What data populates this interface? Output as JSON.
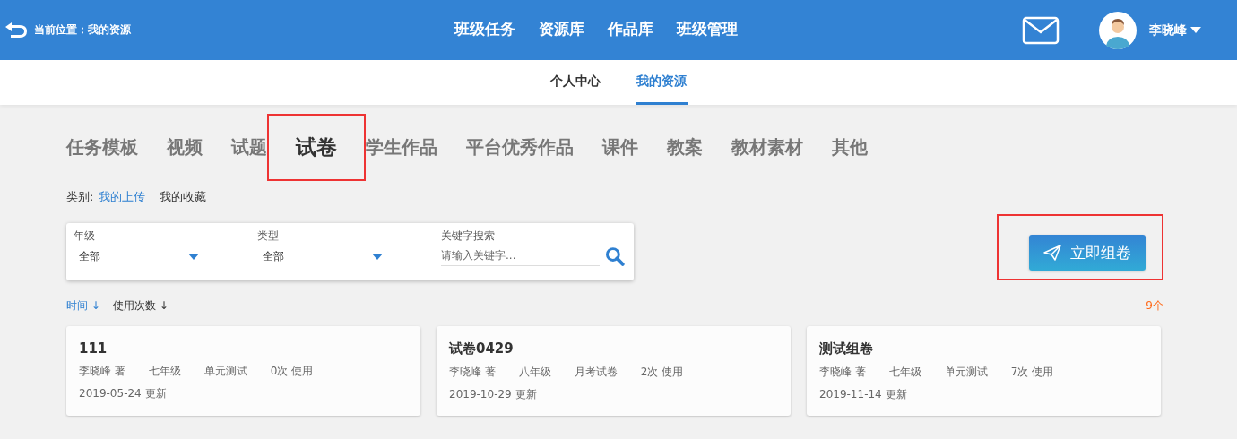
{
  "header": {
    "location": "当前位置：我的资源",
    "nav": [
      {
        "label": "班级任务"
      },
      {
        "label": "资源库"
      },
      {
        "label": "作品库"
      },
      {
        "label": "班级管理"
      }
    ],
    "user": "李晓峰"
  },
  "subnav": [
    {
      "label": "个人中心",
      "selected": false
    },
    {
      "label": "我的资源",
      "selected": true
    }
  ],
  "resource_tabs": [
    {
      "label": "任务模板",
      "selected": false,
      "highlighted": false
    },
    {
      "label": "视频",
      "selected": false,
      "highlighted": false
    },
    {
      "label": "试题",
      "selected": false,
      "highlighted": false
    },
    {
      "label": "试卷",
      "selected": true,
      "highlighted": true
    },
    {
      "label": "学生作品",
      "selected": false,
      "highlighted": false
    },
    {
      "label": "平台优秀作品",
      "selected": false,
      "highlighted": false
    },
    {
      "label": "课件",
      "selected": false,
      "highlighted": false
    },
    {
      "label": "教案",
      "selected": false,
      "highlighted": false
    },
    {
      "label": "教材素材",
      "selected": false,
      "highlighted": false
    },
    {
      "label": "其他",
      "selected": false,
      "highlighted": false
    }
  ],
  "category": {
    "label": "类别:",
    "options": [
      {
        "label": "我的上传",
        "selected": true
      },
      {
        "label": "我的收藏",
        "selected": false
      }
    ]
  },
  "filters": {
    "grade": {
      "label": "年级",
      "value": "全部"
    },
    "type": {
      "label": "类型",
      "value": "全部"
    },
    "keyword": {
      "label": "关键字搜索",
      "placeholder": "请输入关键字..."
    }
  },
  "compose_button": {
    "label": "立即组卷",
    "highlighted": true
  },
  "sort": [
    {
      "label": "时间",
      "arrow": "↓",
      "selected": true
    },
    {
      "label": "使用次数",
      "arrow": "↓",
      "selected": false
    }
  ],
  "count": "9个",
  "papers": [
    {
      "title": "111",
      "author": "李晓峰 著",
      "grade": "七年级",
      "type": "单元测试",
      "uses": "0次 使用",
      "updated": "2019-05-24 更新"
    },
    {
      "title": "试卷0429",
      "author": "李晓峰 著",
      "grade": "八年级",
      "type": "月考试卷",
      "uses": "2次 使用",
      "updated": "2019-10-29 更新"
    },
    {
      "title": "测试组卷",
      "author": "李晓峰 著",
      "grade": "七年级",
      "type": "单元测试",
      "uses": "7次 使用",
      "updated": "2019-11-14 更新"
    }
  ]
}
